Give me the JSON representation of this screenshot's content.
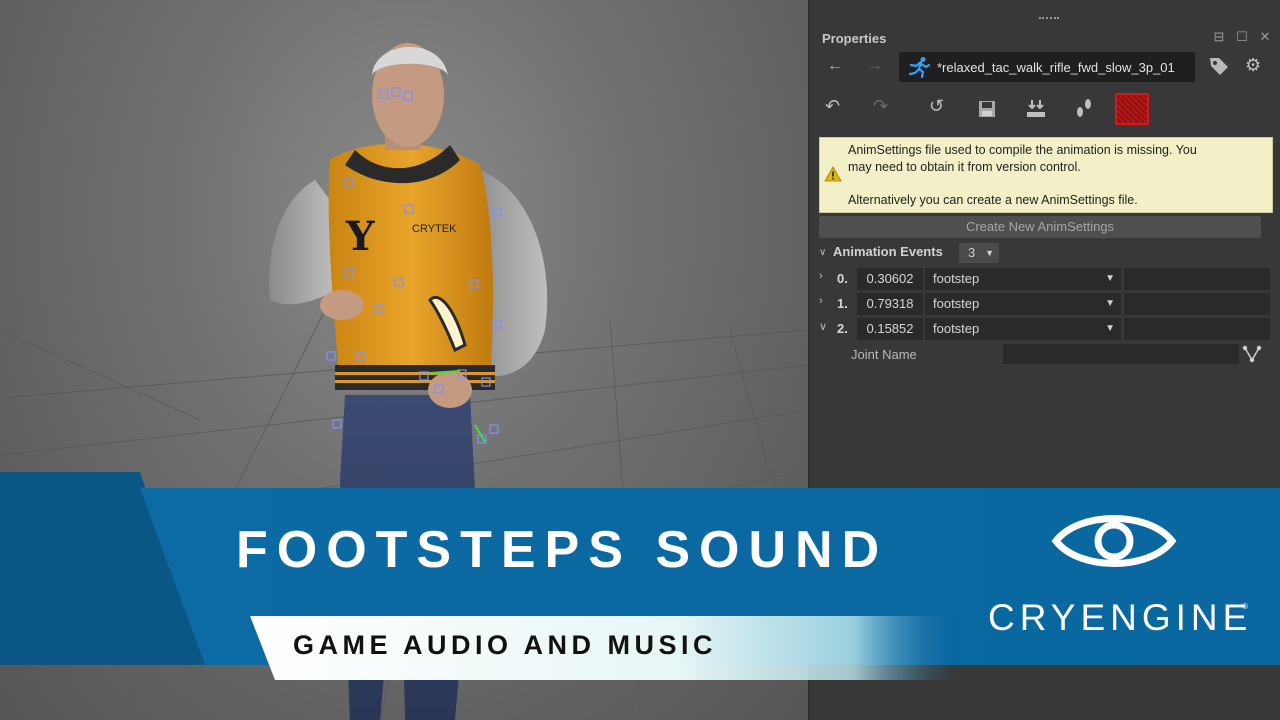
{
  "properties_panel": {
    "title": "Properties",
    "nav_back_icon": "arrow-left-icon",
    "nav_forward_icon": "arrow-right-icon",
    "animation_file": "*relaxed_tac_walk_rifle_fwd_slow_3p_01",
    "toolbar_icons": [
      "undo-icon",
      "redo-icon",
      "revert-icon",
      "save-icon",
      "import-icon",
      "footsteps-icon",
      "record-icon"
    ],
    "warning": {
      "line1": "AnimSettings file used to compile the animation is missing. You",
      "line2": "may need to obtain it from version control.",
      "line3": "Alternatively you can create a new AnimSettings file."
    },
    "create_button": "Create New AnimSettings",
    "animation_events": {
      "label": "Animation Events",
      "count": "3",
      "rows": [
        {
          "index": "0.",
          "time": "0.30602",
          "type": "footstep",
          "expanded": false
        },
        {
          "index": "1.",
          "time": "0.79318",
          "type": "footstep",
          "expanded": false
        },
        {
          "index": "2.",
          "time": "0.15852",
          "type": "footstep",
          "expanded": true
        }
      ],
      "joint_name_label": "Joint Name",
      "joint_name_value": ""
    }
  },
  "banner": {
    "title": "FOOTSTEPS SOUND",
    "subtitle": "GAME AUDIO AND MUSIC",
    "brand": "CRYENGINE",
    "trademark": "®",
    "accent_color": "#0d6aa3",
    "dark_blue": "#0a5a8c"
  },
  "character": {
    "jacket_logo_letter": "Y",
    "jacket_chest_text": "CRYTEK"
  }
}
